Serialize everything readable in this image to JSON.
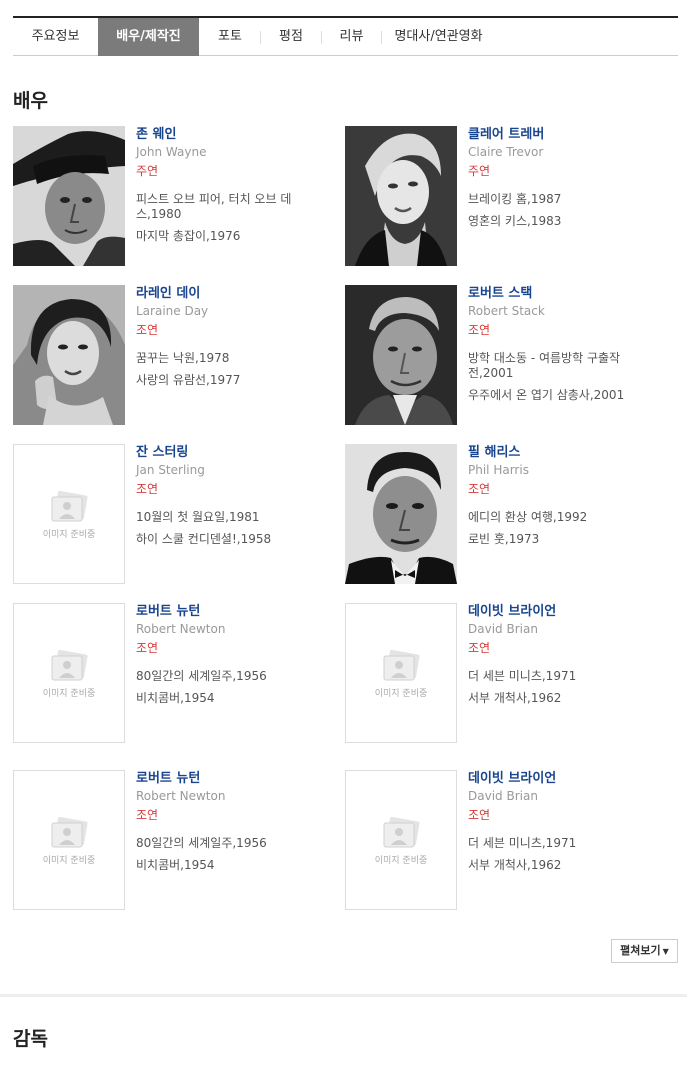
{
  "tabs": [
    {
      "label": "주요정보",
      "active": false
    },
    {
      "label": "배우/제작진",
      "active": true
    },
    {
      "label": "포토",
      "active": false
    },
    {
      "label": "평점",
      "active": false
    },
    {
      "label": "리뷰",
      "active": false
    },
    {
      "label": "명대사/연관영화",
      "active": false
    }
  ],
  "actors_section": {
    "title": "배우"
  },
  "directors_section": {
    "title": "감독"
  },
  "placeholder_text": "이미지 준비중",
  "actors": [
    {
      "name_ko": "존 웨인",
      "name_en": "John Wayne",
      "role": "주연",
      "films": [
        "피스트 오브 피어, 터치 오브 데스,1980",
        "마지막 총잡이,1976"
      ],
      "photo": "portrait-john-wayne"
    },
    {
      "name_ko": "클레어 트레버",
      "name_en": "Claire Trevor",
      "role": "주연",
      "films": [
        "브레이킹 홈,1987",
        "영혼의 키스,1983"
      ],
      "photo": "portrait-claire-trevor"
    },
    {
      "name_ko": "라레인 데이",
      "name_en": "Laraine Day",
      "role": "조연",
      "films": [
        "꿈꾸는 낙원,1978",
        "사랑의 유람선,1977"
      ],
      "photo": "portrait-laraine-day"
    },
    {
      "name_ko": "로버트 스택",
      "name_en": "Robert Stack",
      "role": "조연",
      "films": [
        "방학 대소동 - 여름방학 구출작전,2001",
        "우주에서 온 엽기 삼총사,2001"
      ],
      "photo": "portrait-robert-stack"
    },
    {
      "name_ko": "잔 스터링",
      "name_en": "Jan Sterling",
      "role": "조연",
      "films": [
        "10월의 첫 월요일,1981",
        "하이 스쿨 컨디덴셜!,1958"
      ],
      "photo": "placeholder"
    },
    {
      "name_ko": "필 해리스",
      "name_en": "Phil Harris",
      "role": "조연",
      "films": [
        "에디의 환상 여행,1992",
        "로빈 훗,1973"
      ],
      "photo": "portrait-phil-harris"
    },
    {
      "name_ko": "로버트 뉴턴",
      "name_en": "Robert Newton",
      "role": "조연",
      "films": [
        "80일간의 세계일주,1956",
        "비치콤버,1954"
      ],
      "photo": "placeholder"
    },
    {
      "name_ko": "데이빗 브라이언",
      "name_en": "David Brian",
      "role": "조연",
      "films": [
        "더 세븐 미니츠,1971",
        "서부 개척사,1962"
      ],
      "photo": "placeholder"
    },
    {
      "name_ko": "로버트 뉴턴",
      "name_en": "Robert Newton",
      "role": "조연",
      "films": [
        "80일간의 세계일주,1956",
        "비치콤버,1954"
      ],
      "photo": "placeholder"
    },
    {
      "name_ko": "데이빗 브라이언",
      "name_en": "David Brian",
      "role": "조연",
      "films": [
        "더 세븐 미니츠,1971",
        "서부 개척사,1962"
      ],
      "photo": "placeholder"
    }
  ],
  "expand_button": {
    "label": "펼쳐보기"
  }
}
